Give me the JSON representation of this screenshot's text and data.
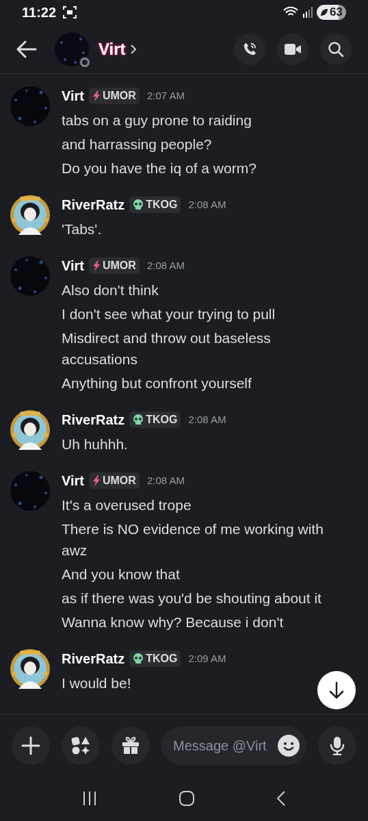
{
  "status_bar": {
    "time": "11:22",
    "battery": "63"
  },
  "header": {
    "title": "Virt"
  },
  "messages": [
    {
      "author": "Virt",
      "avatar": {
        "kind": "picture"
      },
      "tag": {
        "kind": "bolt",
        "label": "UMOR"
      },
      "time": "2:07 AM",
      "lines": [
        "tabs on a guy prone to raiding",
        "and harrassing people?",
        "Do you have the iq of a worm?"
      ]
    },
    {
      "author": "RiverRatz",
      "avatar": {
        "kind": "picture"
      },
      "tag": {
        "kind": "skull",
        "label": "TKOG"
      },
      "time": "2:08 AM",
      "lines": [
        "'Tabs'."
      ]
    },
    {
      "author": "Virt",
      "avatar": {
        "kind": "picture"
      },
      "tag": {
        "kind": "bolt",
        "label": "UMOR"
      },
      "time": "2:08 AM",
      "lines": [
        "Also don't think",
        "I don't see what your trying to pull",
        "Misdirect and throw out baseless accusations",
        "Anything but confront yourself"
      ]
    },
    {
      "author": "RiverRatz",
      "avatar": {
        "kind": "picture"
      },
      "tag": {
        "kind": "skull",
        "label": "TKOG"
      },
      "time": "2:08 AM",
      "lines": [
        "Uh huhhh."
      ]
    },
    {
      "author": "Virt",
      "avatar": {
        "kind": "picture"
      },
      "tag": {
        "kind": "bolt",
        "label": "UMOR"
      },
      "time": "2:08 AM",
      "lines": [
        "It's a overused trope",
        "There is NO evidence of me working with awz",
        "And you know that",
        "as if there was you'd be shouting about it",
        "Wanna know why? Because i don't"
      ]
    },
    {
      "author": "RiverRatz",
      "avatar": {
        "kind": "picture"
      },
      "tag": {
        "kind": "skull",
        "label": "TKOG"
      },
      "time": "2:09 AM",
      "lines": [
        "I would be!"
      ]
    }
  ],
  "composer": {
    "placeholder": "Message @Virt"
  }
}
